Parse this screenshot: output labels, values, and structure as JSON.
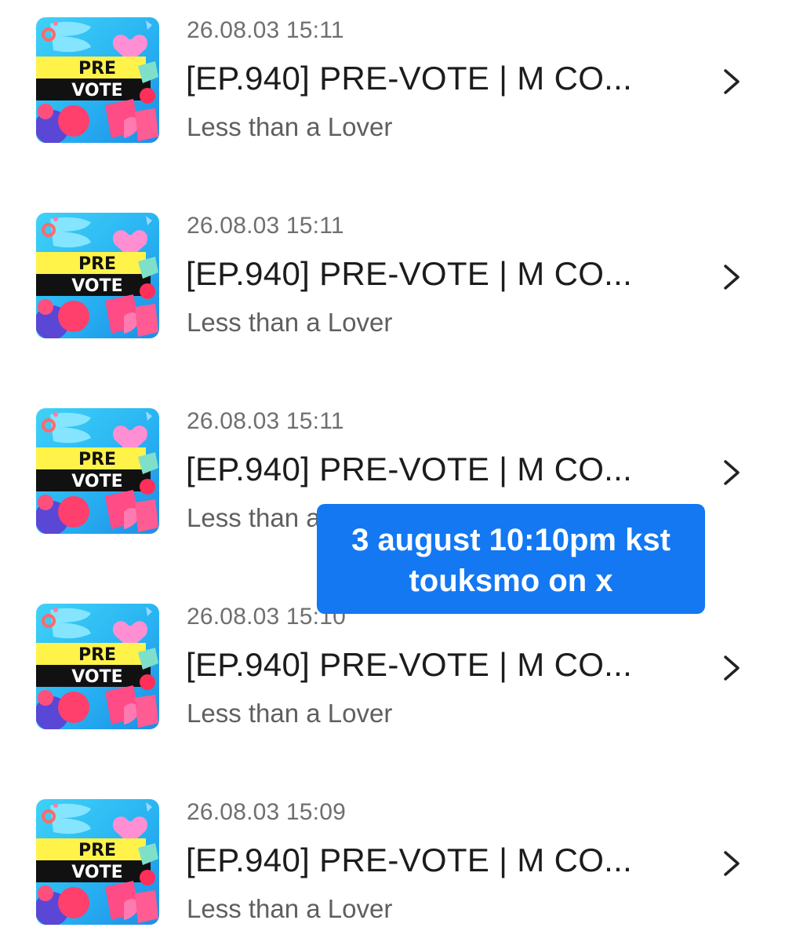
{
  "episodes": [
    {
      "timestamp": "26.08.03 15:11",
      "title": "[EP.940] PRE-VOTE | M CO...",
      "subtitle": "Less than a Lover",
      "thumbnail_line1": "PRE",
      "thumbnail_line2": "VOTE",
      "icon": "chevron-right-icon"
    },
    {
      "timestamp": "26.08.03 15:11",
      "title": "[EP.940] PRE-VOTE | M CO...",
      "subtitle": "Less than a Lover",
      "thumbnail_line1": "PRE",
      "thumbnail_line2": "VOTE",
      "icon": "chevron-right-icon"
    },
    {
      "timestamp": "26.08.03 15:11",
      "title": "[EP.940] PRE-VOTE | M CO...",
      "subtitle": "Less than a Lover",
      "thumbnail_line1": "PRE",
      "thumbnail_line2": "VOTE",
      "icon": "chevron-right-icon"
    },
    {
      "timestamp": "26.08.03 15:10",
      "title": "[EP.940] PRE-VOTE | M CO...",
      "subtitle": "Less than a Lover",
      "thumbnail_line1": "PRE",
      "thumbnail_line2": "VOTE",
      "icon": "chevron-right-icon"
    },
    {
      "timestamp": "26.08.03 15:09",
      "title": "[EP.940] PRE-VOTE | M CO...",
      "subtitle": "Less than a Lover",
      "thumbnail_line1": "PRE",
      "thumbnail_line2": "VOTE",
      "icon": "chevron-right-icon"
    }
  ],
  "overlay": {
    "line1": "3 august 10:10pm kst",
    "line2": "touksmo on x",
    "background": "#1378f2"
  },
  "colors": {
    "title": "#1c1c1c",
    "timestamp": "#6f6f6f",
    "subtitle": "#5f5f5f",
    "thumbnail_bg": "#2bb8f5",
    "thumbnail_banner": "#fff34a"
  }
}
